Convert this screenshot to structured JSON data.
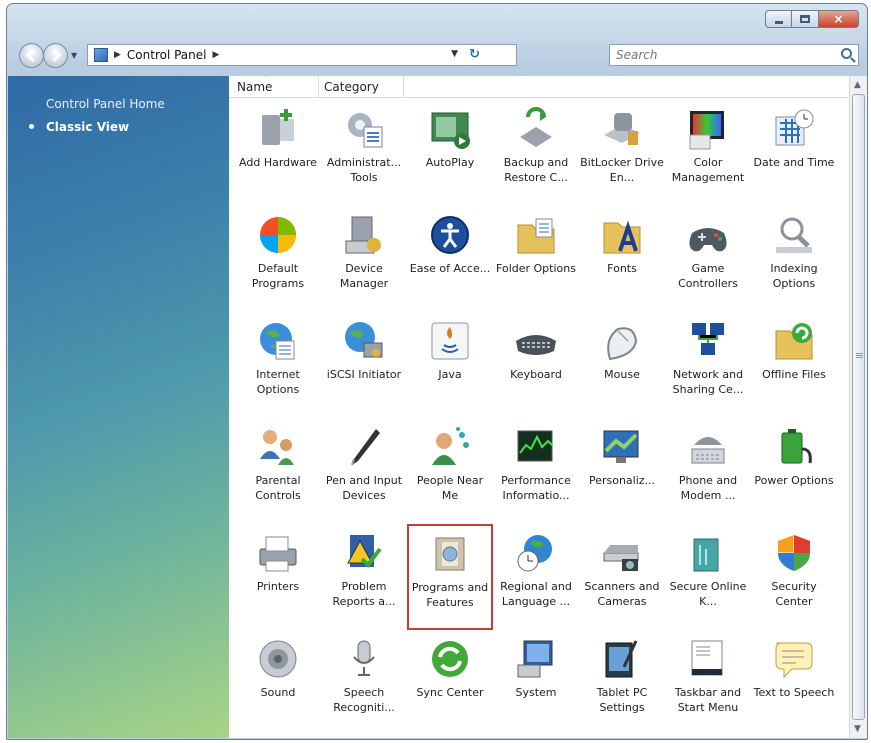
{
  "window": {
    "caption_buttons": [
      "minimize",
      "maximize",
      "close"
    ],
    "close_glyph": "×"
  },
  "address": {
    "crumb": "Control Panel",
    "arrow": "▶"
  },
  "search": {
    "placeholder": "Search"
  },
  "sidebar": {
    "home": "Control Panel Home",
    "classic": "Classic View"
  },
  "columns": {
    "name": "Name",
    "category": "Category"
  },
  "items": [
    {
      "label": "Add Hardware",
      "icon": "add-hardware-icon"
    },
    {
      "label": "Administrat... Tools",
      "icon": "administrative-tools-icon"
    },
    {
      "label": "AutoPlay",
      "icon": "autoplay-icon"
    },
    {
      "label": "Backup and Restore C...",
      "icon": "backup-restore-icon"
    },
    {
      "label": "BitLocker Drive En...",
      "icon": "bitlocker-icon"
    },
    {
      "label": "Color Management",
      "icon": "color-management-icon"
    },
    {
      "label": "Date and Time",
      "icon": "date-time-icon"
    },
    {
      "label": "Default Programs",
      "icon": "default-programs-icon"
    },
    {
      "label": "Device Manager",
      "icon": "device-manager-icon"
    },
    {
      "label": "Ease of Acce...",
      "icon": "ease-of-access-icon"
    },
    {
      "label": "Folder Options",
      "icon": "folder-options-icon"
    },
    {
      "label": "Fonts",
      "icon": "fonts-icon"
    },
    {
      "label": "Game Controllers",
      "icon": "game-controllers-icon"
    },
    {
      "label": "Indexing Options",
      "icon": "indexing-options-icon"
    },
    {
      "label": "Internet Options",
      "icon": "internet-options-icon"
    },
    {
      "label": "iSCSI Initiator",
      "icon": "iscsi-initiator-icon"
    },
    {
      "label": "Java",
      "icon": "java-icon"
    },
    {
      "label": "Keyboard",
      "icon": "keyboard-icon"
    },
    {
      "label": "Mouse",
      "icon": "mouse-icon"
    },
    {
      "label": "Network and Sharing Ce...",
      "icon": "network-sharing-icon"
    },
    {
      "label": "Offline Files",
      "icon": "offline-files-icon"
    },
    {
      "label": "Parental Controls",
      "icon": "parental-controls-icon"
    },
    {
      "label": "Pen and Input Devices",
      "icon": "pen-input-icon"
    },
    {
      "label": "People Near Me",
      "icon": "people-near-me-icon"
    },
    {
      "label": "Performance Informatio...",
      "icon": "performance-icon"
    },
    {
      "label": "Personaliz...",
      "icon": "personalization-icon"
    },
    {
      "label": "Phone and Modem ...",
      "icon": "phone-modem-icon"
    },
    {
      "label": "Power Options",
      "icon": "power-options-icon"
    },
    {
      "label": "Printers",
      "icon": "printers-icon"
    },
    {
      "label": "Problem Reports a...",
      "icon": "problem-reports-icon"
    },
    {
      "label": "Programs and Features",
      "icon": "programs-features-icon",
      "selected": true
    },
    {
      "label": "Regional and Language ...",
      "icon": "regional-language-icon"
    },
    {
      "label": "Scanners and Cameras",
      "icon": "scanners-cameras-icon"
    },
    {
      "label": "Secure Online K...",
      "icon": "secure-online-icon"
    },
    {
      "label": "Security Center",
      "icon": "security-center-icon"
    },
    {
      "label": "Sound",
      "icon": "sound-icon"
    },
    {
      "label": "Speech Recogniti...",
      "icon": "speech-recognition-icon"
    },
    {
      "label": "Sync Center",
      "icon": "sync-center-icon"
    },
    {
      "label": "System",
      "icon": "system-icon"
    },
    {
      "label": "Tablet PC Settings",
      "icon": "tablet-pc-icon"
    },
    {
      "label": "Taskbar and Start Menu",
      "icon": "taskbar-start-icon"
    },
    {
      "label": "Text to Speech",
      "icon": "text-to-speech-icon"
    }
  ]
}
